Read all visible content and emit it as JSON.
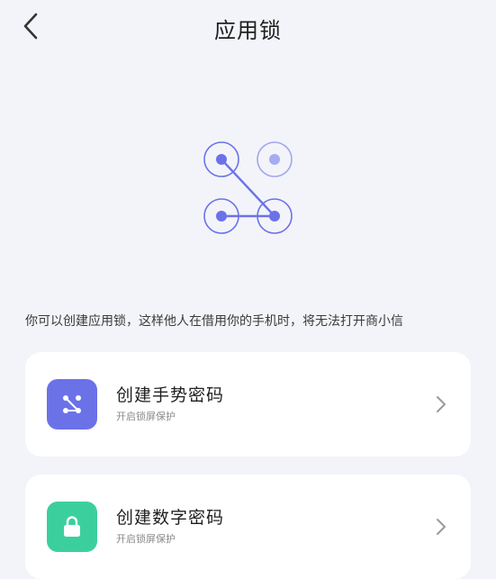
{
  "header": {
    "title": "应用锁",
    "back_icon": "chevron-left-icon"
  },
  "hero": {
    "icon": "pattern-lock-icon",
    "accent_color": "#6b72e8"
  },
  "description": "你可以创建应用锁，这样他人在借用你的手机时，将无法打开商小信",
  "options": [
    {
      "title": "创建手势密码",
      "subtitle": "开启锁屏保护",
      "icon": "gesture-pattern-icon",
      "icon_bg": "#6b72e8"
    },
    {
      "title": "创建数字密码",
      "subtitle": "开启锁屏保护",
      "icon": "padlock-icon",
      "icon_bg": "#3ccf9e"
    }
  ],
  "colors": {
    "background": "#f3f4f9",
    "card": "#ffffff",
    "chevron": "#9a9a9a"
  }
}
